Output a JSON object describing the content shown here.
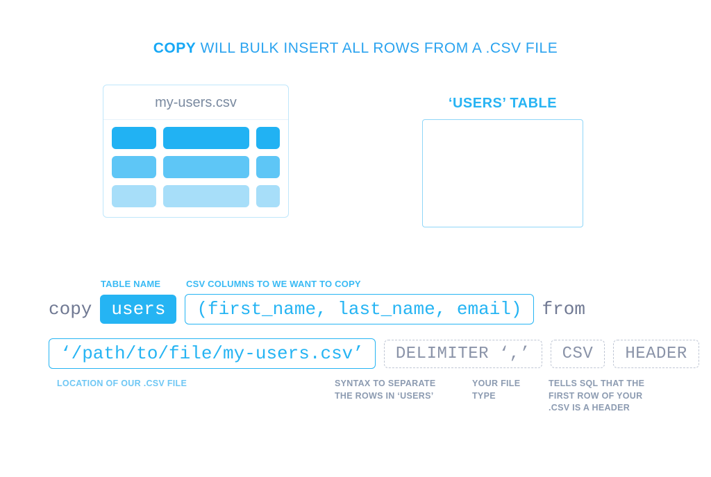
{
  "headline": {
    "bold": "COPY",
    "rest": " WILL BULK INSERT ALL ROWS FROM A .CSV FILE"
  },
  "csv": {
    "filename": "my-users.csv"
  },
  "usersTable": {
    "label": "‘USERS’ TABLE"
  },
  "labels": {
    "tableName": "TABLE NAME",
    "csvColumns": "CSV COLUMNS TO WE WANT TO COPY"
  },
  "code": {
    "copy": "copy",
    "tableToken": "users",
    "columnsToken": "(first_name, last_name, email)",
    "from": "from",
    "pathToken": "‘/path/to/file/my-users.csv’",
    "delimiterToken": "DELIMITER ‘,’",
    "csvToken": "CSV",
    "headerToken": "HEADER"
  },
  "captions": {
    "location": "LOCATION OF OUR .CSV FILE",
    "delimiter": "SYNTAX TO SEPARATE THE ROWS IN ‘USERS’",
    "filetype": "YOUR FILE TYPE",
    "header": "TELLS SQL THAT THE FIRST ROW OF YOUR .CSV IS A HEADER"
  }
}
